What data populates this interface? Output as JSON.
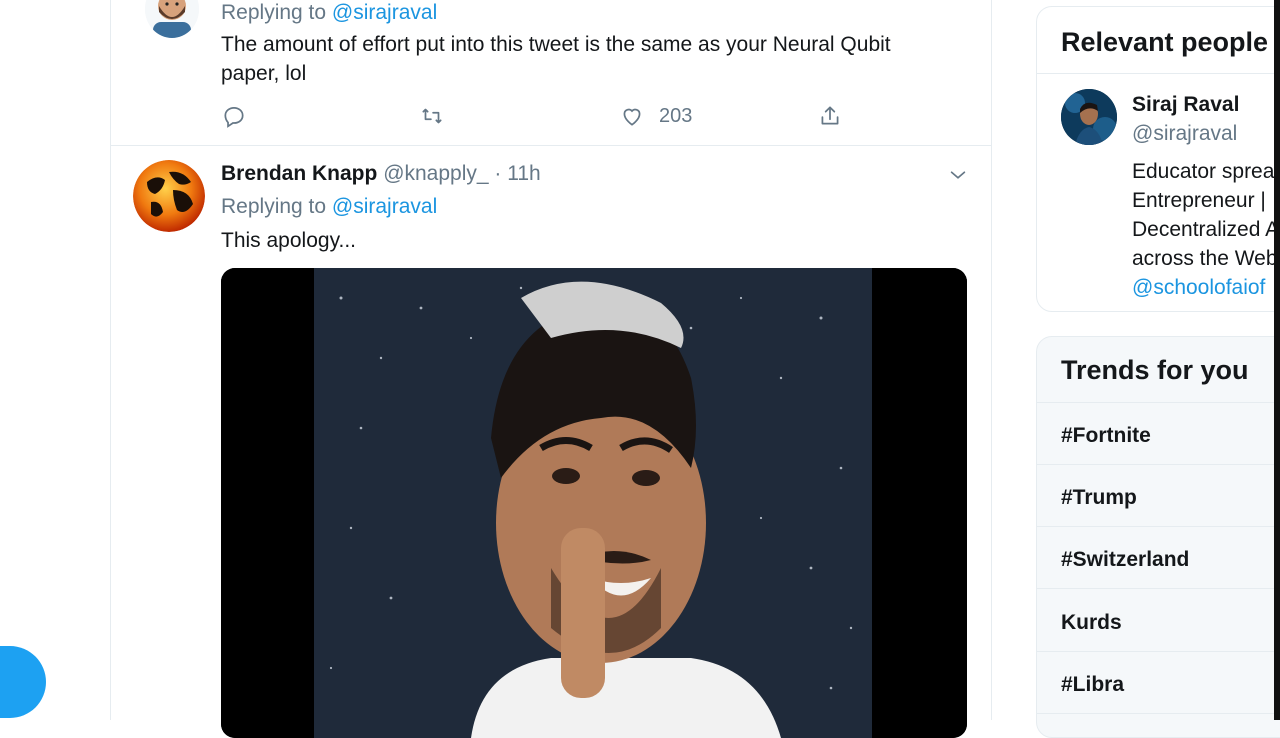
{
  "tweet_top": {
    "replying_prefix": "Replying to",
    "replying_handle": "@sirajraval",
    "text_line1": "The amount of effort put into this tweet is the same as your Neural Qubit",
    "text_line2": "paper, lol",
    "like_count": "203",
    "icons": [
      "reply-icon",
      "retweet-icon",
      "like-icon",
      "share-icon"
    ]
  },
  "tweet_2": {
    "author_name": "Brendan Knapp",
    "author_handle": "@knapply_",
    "time": "· 11h",
    "replying_prefix": "Replying to",
    "replying_handle": "@sirajraval",
    "text": "This apology..."
  },
  "sidebar": {
    "relevant_title": "Relevant people",
    "person": {
      "name": "Siraj Raval",
      "handle": "@sirajraval",
      "bio_lines": [
        "Educator sprea",
        "Entrepreneur |",
        "Decentralized A",
        "across the Web"
      ],
      "bio_link": "@schoolofaiof"
    },
    "trends_title": "Trends for you",
    "trends": [
      "#Fortnite",
      "#Trump",
      "#Switzerland",
      "Kurds",
      "#Libra"
    ]
  },
  "colors": {
    "accent": "#1da1f2",
    "link": "#1b95e0",
    "muted": "#657786"
  }
}
